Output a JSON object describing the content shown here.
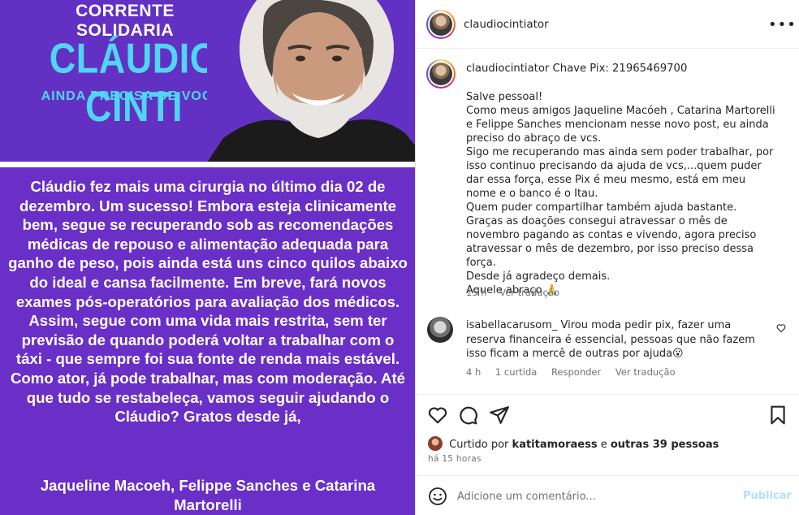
{
  "image": {
    "top_label": "CORRENTE SOLIDARIA",
    "name": "CLÁUDIO CINTI",
    "subtitle": "AINDA PRECISA DE VOCÊ!",
    "body": "Cláudio fez mais uma cirurgia no último dia 02 de dezembro. Um sucesso! Embora esteja clinicamente bem, segue se recuperando sob as recomendações médicas de repouso e alimentação adequada para ganho de peso, pois ainda está uns cinco quilos abaixo do ideal e cansa facilmente. Em breve, fará novos exames pós-operatórios para avaliação dos médicos. Assim, segue com uma vida mais restrita, sem ter previsão de quando poderá voltar a trabalhar com o táxi -  que sempre foi sua fonte de renda mais estável. Como ator, já pode trabalhar, mas com moderação. Até que tudo se restabeleça, vamos seguir ajudando o Cláudio? Gratos desde já,",
    "signature": "Jaqueline Macoeh, Felippe Sanches e Catarina Martorelli",
    "colors": {
      "purple": "#6a2fc7",
      "cyan": "#4fd6f2"
    }
  },
  "header": {
    "username": "claudiocintiator",
    "more_icon": "more-horizontal-icon"
  },
  "caption": {
    "username": "claudiocintiator",
    "headline": "Chave Pix: 21965469700",
    "lines": [
      "Salve pessoal!",
      "Como meus amigos Jaqueline Macóeh , Catarina Martorelli e Felippe Sanches mencionam nesse novo post, eu ainda preciso do abraço de vcs.",
      "Sigo me recuperando mas ainda sem poder trabalhar, por isso continuo precisando da ajuda de vcs,...quem puder dar essa força, esse Pix é meu mesmo, está em meu nome e o banco é o Itau.",
      "Quem puder compartilhar também ajuda bastante.",
      "Graças as doações consegui atravessar o mês de novembro pagando as contas e vivendo, agora preciso atravessar o mês de dezembro, por isso preciso dessa força.",
      "Desde já agradeço demais.",
      "Aquele abraço 🙏"
    ],
    "time": "15 h",
    "translate": "Ver tradução"
  },
  "comment": {
    "username": "isabellacarusom_",
    "text": "Virou moda pedir pix, fazer uma reserva financeira é essencial, pessoas que não fazem isso ficam a mercê de outras por ajuda😮",
    "time": "4 h",
    "likes": "1 curtida",
    "reply": "Responder",
    "translate": "Ver tradução"
  },
  "actions": {
    "icons": [
      "heart-icon",
      "comment-icon",
      "share-icon",
      "bookmark-icon"
    ]
  },
  "likes": {
    "prefix": "Curtido por",
    "user": "katitamoraess",
    "middle": "e",
    "others": "outras 39 pessoas"
  },
  "timestamp": "há 15 horas",
  "comment_box": {
    "placeholder": "Adicione um comentário...",
    "publish": "Publicar"
  }
}
